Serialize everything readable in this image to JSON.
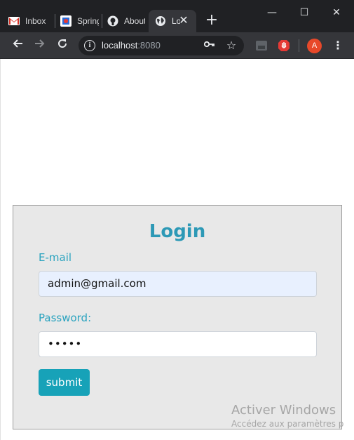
{
  "browser": {
    "tabs": [
      {
        "label": "Inbox",
        "icon": "gmail-icon",
        "active": false
      },
      {
        "label": "Spring",
        "icon": "spring-icon",
        "active": false
      },
      {
        "label": "About",
        "icon": "github-icon",
        "active": false
      },
      {
        "label": "Login",
        "icon": "globe-icon",
        "active": true
      }
    ],
    "new_tab_glyph": "+",
    "window_controls": {
      "minimize": "—",
      "maximize": "☐",
      "close": "✕"
    },
    "address": {
      "host": "localhost",
      "port": ":8080"
    },
    "avatar_letter": "A",
    "colors": {
      "tabstrip": "#202124",
      "toolbar": "#35363a",
      "avatar": "#e8492a"
    }
  },
  "login": {
    "title": "Login",
    "email_label": "E-mail",
    "email_value": "admin@gmail.com",
    "password_label": "Password:",
    "password_value": "•••••",
    "submit_label": "submit",
    "colors": {
      "title": "#2d99b6",
      "button": "#17a2b8",
      "card": "#e8e8e8",
      "email_autofill": "#e8f0fe"
    }
  },
  "os_watermark": {
    "line1": "Activer Windows",
    "line2": "Accédez aux paramètres p"
  }
}
